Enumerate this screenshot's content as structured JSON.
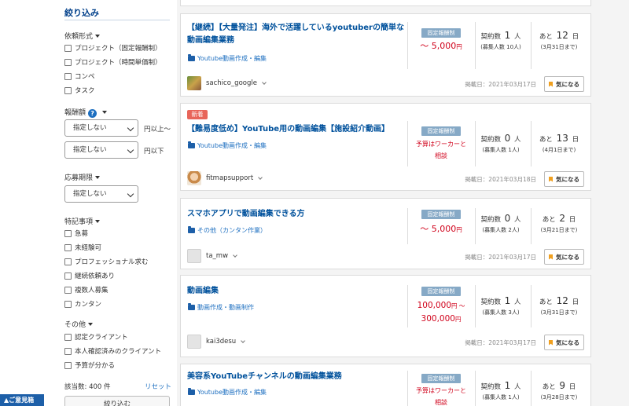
{
  "sidebar": {
    "title": "絞り込み",
    "request_type": {
      "label": "依頼形式",
      "options": [
        "プロジェクト（固定報酬制）",
        "プロジェクト（時間単価制）",
        "コンペ",
        "タスク"
      ]
    },
    "reward": {
      "label": "報酬額",
      "help": "?",
      "min_value": "指定しない",
      "min_suffix": "円以上〜",
      "max_value": "指定しない",
      "max_suffix": "円以下"
    },
    "deadline": {
      "label": "応募期限",
      "value": "指定しない"
    },
    "special": {
      "label": "特記事項",
      "options": [
        "急募",
        "未経験可",
        "プロフェッショナル求む",
        "継続依頼あり",
        "複数人募集",
        "カンタン"
      ]
    },
    "other": {
      "label": "その他",
      "options": [
        "認定クライアント",
        "本人確認済みのクライアント",
        "予算が分かる"
      ]
    },
    "hit_count": "該当数: 400 件",
    "reset": "リセット",
    "submit": "絞り込む",
    "feedback": "▲ご意見箱"
  },
  "jobs": [
    {
      "title": "【継続】【大量発注】海外で活躍しているyoutuberの簡単な動画編集業務",
      "category": "Youtube動画作成・編集",
      "price_type": "固定報酬制",
      "price_line1": "〜 5,000",
      "price_unit": "円",
      "contracts_label": "契約数",
      "contracts_count": "1",
      "contracts_unit": "人",
      "recruit": "(募集人数 10人)",
      "days_prefix": "あと",
      "days": "12",
      "days_unit": "日",
      "deadline_date": "(3月31日まで)",
      "user": "sachico_google",
      "posted": "掲載日：2021年03月17日",
      "fav": "気になる"
    },
    {
      "badge": "新着",
      "title": "【難易度低め】YouTube用の動画編集【施設紹介動画】",
      "category": "Youtube動画作成・編集",
      "price_type": "固定報酬制",
      "budget_line1": "予算はワーカーと",
      "budget_line2": "相談",
      "contracts_label": "契約数",
      "contracts_count": "0",
      "contracts_unit": "人",
      "recruit": "(募集人数 1人)",
      "days_prefix": "あと",
      "days": "13",
      "days_unit": "日",
      "deadline_date": "(4月1日まで)",
      "user": "fitmapsupport",
      "posted": "掲載日：2021年03月18日",
      "fav": "気になる"
    },
    {
      "title": "スマホアプリで動画編集できる方",
      "category": "その他（カンタン作業）",
      "price_type": "固定報酬制",
      "price_line1": "〜 5,000",
      "price_unit": "円",
      "contracts_label": "契約数",
      "contracts_count": "0",
      "contracts_unit": "人",
      "recruit": "(募集人数 2人)",
      "days_prefix": "あと",
      "days": "2",
      "days_unit": "日",
      "deadline_date": "(3月21日まで)",
      "user": "ta_mw",
      "posted": "掲載日：2021年03月17日",
      "fav": "気になる"
    },
    {
      "title": "動画編集",
      "category": "動画作成・動画制作",
      "price_type": "固定報酬制",
      "price_line1": "100,000",
      "price_line1_suffix": "円 〜",
      "price_line2": "300,000",
      "price_unit": "円",
      "contracts_label": "契約数",
      "contracts_count": "1",
      "contracts_unit": "人",
      "recruit": "(募集人数 3人)",
      "days_prefix": "あと",
      "days": "12",
      "days_unit": "日",
      "deadline_date": "(3月31日まで)",
      "user": "kai3desu",
      "posted": "掲載日：2021年03月17日",
      "fav": "気になる"
    },
    {
      "title": "美容系YouTubeチャンネルの動画編集業務",
      "category": "Youtube動画作成・編集",
      "price_type": "固定報酬制",
      "budget_line1": "予算はワーカーと",
      "budget_line2": "相談",
      "contracts_label": "契約数",
      "contracts_count": "1",
      "contracts_unit": "人",
      "recruit": "(募集人数 1人)",
      "days_prefix": "あと",
      "days": "9",
      "days_unit": "日",
      "deadline_date": "(3月28日まで)"
    }
  ],
  "colors": {
    "accent": "#00519c",
    "price_red": "#d0021b",
    "new_badge": "#e8655a",
    "price_badge": "#86a9c6"
  }
}
